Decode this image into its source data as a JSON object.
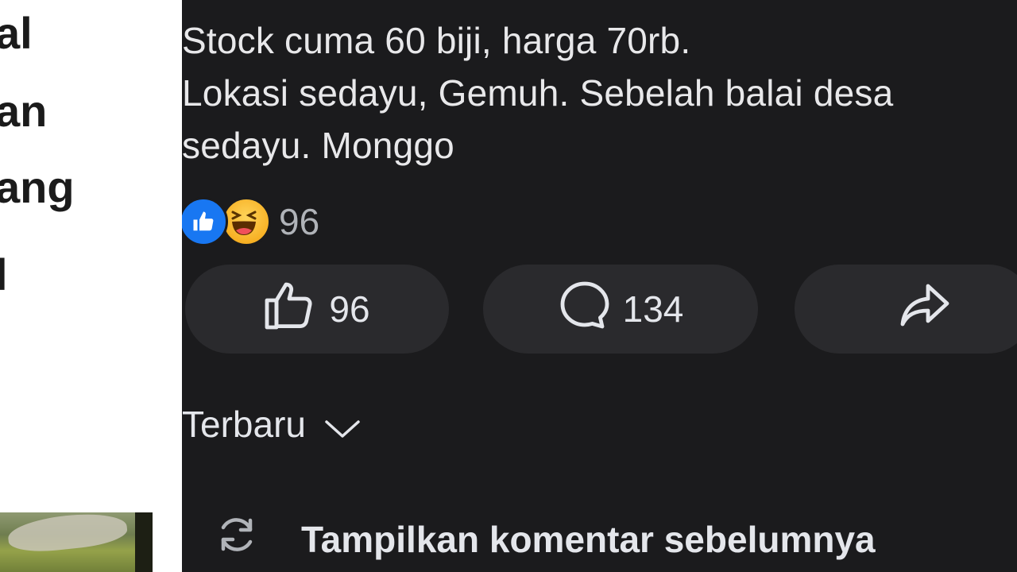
{
  "article": {
    "lines": [
      "al",
      "an",
      "ang",
      "l"
    ]
  },
  "post": {
    "lines": [
      "Stock cuma 60 biji, harga 70rb.",
      "Lokasi sedayu, Gemuh. Sebelah balai desa",
      "sedayu. Monggo"
    ]
  },
  "reactions": {
    "icons": [
      "like-icon",
      "haha-icon"
    ],
    "count": "96"
  },
  "actions": {
    "like_count": "96",
    "comment_count": "134",
    "share_icon": "share-arrow-icon"
  },
  "comments": {
    "sort_label": "Terbaru",
    "show_previous_label": "Tampilkan komentar sebelumnya"
  },
  "colors": {
    "background": "#1b1b1d",
    "button": "#2a2a2d",
    "like_blue": "#1877f2",
    "haha_yellow": "#f7b125",
    "text": "#e4e6eb",
    "muted": "#b0b3b8"
  }
}
